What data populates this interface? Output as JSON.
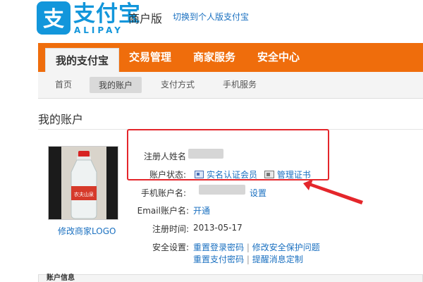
{
  "header": {
    "logo_title": "支付宝",
    "logo_sub": "ALIPAY",
    "logo_glyph": "支",
    "merchant_title": "商户版",
    "switch_link": "切换到个人版支付宝"
  },
  "main_nav": {
    "tabs": [
      {
        "label": "我的支付宝",
        "active": true
      },
      {
        "label": "交易管理",
        "active": false
      },
      {
        "label": "商家服务",
        "active": false
      },
      {
        "label": "安全中心",
        "active": false
      }
    ]
  },
  "sub_nav": {
    "items": [
      {
        "label": "首页",
        "active": false
      },
      {
        "label": "我的账户",
        "active": true
      },
      {
        "label": "支付方式",
        "active": false
      },
      {
        "label": "手机服务",
        "active": false
      }
    ]
  },
  "page_title": "我的账户",
  "avatar": {
    "edit_link": "修改商家LOGO",
    "bottle_label": "农夫山泉"
  },
  "account": {
    "registered_name_label": "注册人姓名",
    "status_label": "账户状态:",
    "status_verified": "实名认证会员",
    "manage_cert": "管理证书",
    "mobile_label": "手机账户名:",
    "mobile_action": "设置",
    "email_label": "Email账户名:",
    "email_action": "开通",
    "register_time_label": "注册时间:",
    "register_time": "2013-05-17",
    "security_label": "安全设置:",
    "security_links": [
      "重置登录密码",
      "修改安全保护问题",
      "重置支付密码",
      "提醒消息定制"
    ]
  },
  "bottom_section_title": "账户信息",
  "colors": {
    "brand_blue": "#1296db",
    "nav_orange": "#ef6d0c",
    "link_blue": "#1a70c0",
    "highlight_red": "#e4262b"
  }
}
